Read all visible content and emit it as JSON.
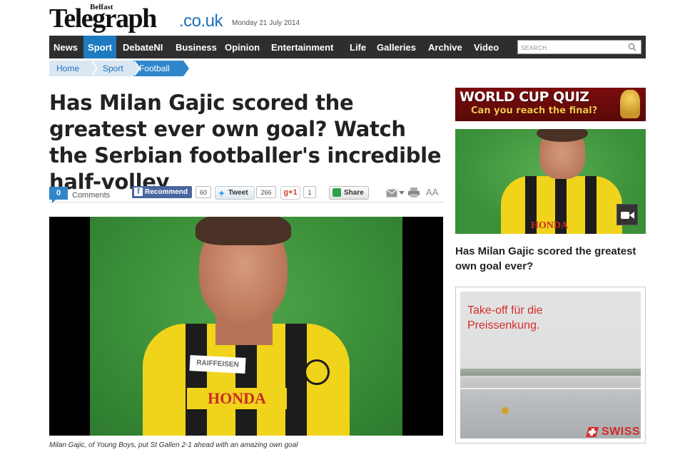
{
  "masthead": {
    "logo_small": "Belfast",
    "logo_main": "Telegraph",
    "logo_suffix": ".co.uk",
    "date": "Monday 21 July 2014"
  },
  "nav": {
    "items": [
      "News",
      "Sport",
      "DebateNI",
      "Business",
      "Opinion",
      "Entertainment",
      "Life",
      "Galleries",
      "Archive",
      "Video"
    ],
    "active": "Sport",
    "search_placeholder": "SEARCH"
  },
  "breadcrumb": [
    "Home",
    "Sport",
    "Football"
  ],
  "article": {
    "headline": "Has Milan Gajic scored the greatest ever own goal? Watch the Serbian footballer's incredible half-volley",
    "caption": "Milan Gajic, of Young Boys, put St Gallen 2-1 ahead with an amazing own goal",
    "video_text": {
      "sponsor1": "RAIFFEISEN",
      "sponsor2": "HONDA"
    }
  },
  "share": {
    "comments_count": "0",
    "comments_label": "Comments",
    "recommend_label": "Recommend",
    "recommend_count": "60",
    "tweet_label": "Tweet",
    "tweet_count": "266",
    "gplus_label": "g+1",
    "gplus_count": "1",
    "share_label": "Share",
    "font_size_label": "AA"
  },
  "sidebar": {
    "quiz_title": "WORLD CUP QUIZ",
    "quiz_subtitle": "Can you reach the final?",
    "thumb_text": "HONDA",
    "related_title": "Has Milan Gajic scored the greatest own goal ever?",
    "ad_text_line1": "Take-off für die",
    "ad_text_line2": "Preissenkung.",
    "ad_brand": "SWISS"
  },
  "colors": {
    "nav_bg": "#2e2e2e",
    "nav_active": "#1f7bc1",
    "brand_blue": "#1d6fb8",
    "swiss_red": "#d42c2b"
  }
}
